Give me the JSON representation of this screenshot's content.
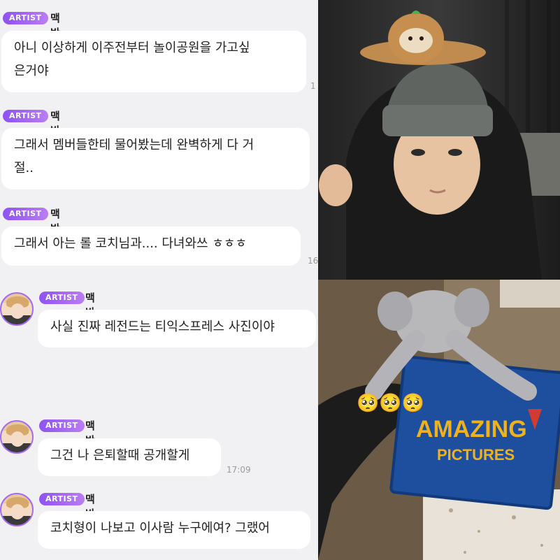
{
  "badge_label": "ARTIST",
  "sender_name": "맥반석",
  "messages": [
    {
      "text_line1": "아니 이상하게 이주전부터 놀이공원을 가고싶",
      "text_line2": "은거야",
      "time": "1"
    },
    {
      "text_line1": "그래서 멤버들한테 물어봤는데 완벽하게 다 거",
      "text_line2": "절..",
      "time": ""
    },
    {
      "text_line1": "그래서 아는 롤 코치님과.... 다녀와쓰 ㅎㅎㅎ",
      "time": "16"
    },
    {
      "text_line1": "사실 진짜 레전드는 티익스프레스 사진이야",
      "time": ""
    },
    {
      "text_line1": "그건 나 은퇴할때 공개할게",
      "time": "17:09"
    },
    {
      "text_line1": "코치형이 나보고 이사람 누구에여? 그랬어",
      "time": ""
    }
  ],
  "photo_bottom": {
    "emoji": "🥺🥺🥺",
    "sign_line1": "AMAZING",
    "sign_line2": "PICTURES"
  },
  "colors": {
    "accent": "#9b5cf6",
    "chat_bg": "#f1f1f4",
    "bubble": "#ffffff"
  }
}
